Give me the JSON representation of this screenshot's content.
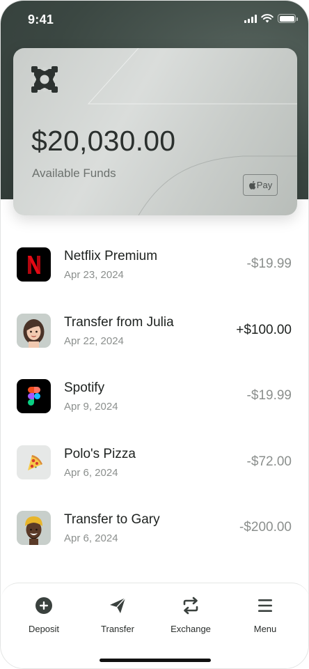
{
  "status_bar": {
    "time": "9:41"
  },
  "card": {
    "balance": "$20,030.00",
    "label": "Available Funds",
    "apple_pay": "Pay"
  },
  "transactions": [
    {
      "title": "Netflix Premium",
      "date": "Apr 23, 2024",
      "amount": "-$19.99",
      "icon": "netflix-logo"
    },
    {
      "title": "Transfer from Julia",
      "date": "Apr 22, 2024",
      "amount": "+$100.00",
      "icon": "julia-avatar"
    },
    {
      "title": "Spotify",
      "date": "Apr 9, 2024",
      "amount": "-$19.99",
      "icon": "figma-logo"
    },
    {
      "title": "Polo's Pizza",
      "date": "Apr 6, 2024",
      "amount": "-$72.00",
      "icon": "pizza-emoji"
    },
    {
      "title": "Transfer to Gary",
      "date": "Apr 6, 2024",
      "amount": "-$200.00",
      "icon": "gary-avatar"
    }
  ],
  "nav": {
    "deposit": "Deposit",
    "transfer": "Transfer",
    "exchange": "Exchange",
    "menu": "Menu"
  },
  "colors": {
    "header_bg": "#3b4742",
    "card_bg": "#d4d8d5",
    "text_primary": "#1d211f",
    "text_secondary": "#8b8f8d"
  }
}
